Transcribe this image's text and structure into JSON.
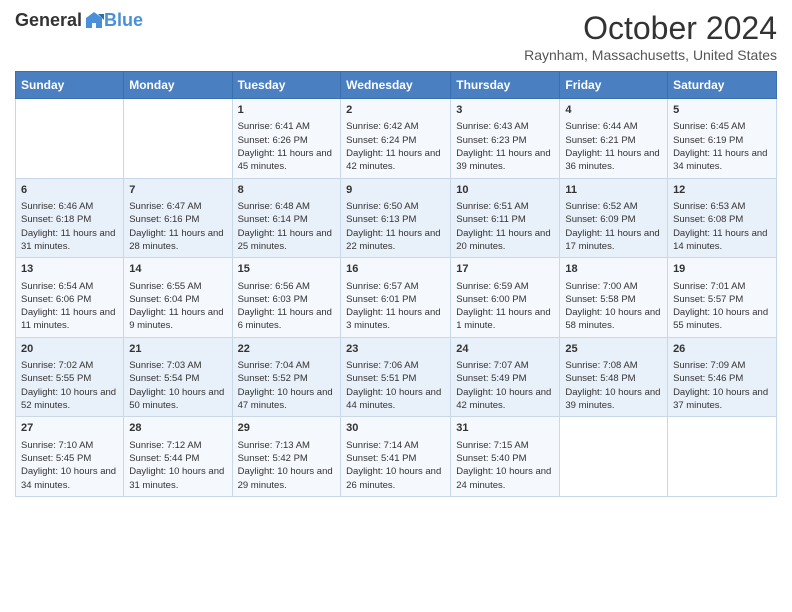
{
  "header": {
    "logo": {
      "general": "General",
      "blue": "Blue"
    },
    "title": "October 2024",
    "location": "Raynham, Massachusetts, United States"
  },
  "days_of_week": [
    "Sunday",
    "Monday",
    "Tuesday",
    "Wednesday",
    "Thursday",
    "Friday",
    "Saturday"
  ],
  "weeks": [
    [
      {
        "day": "",
        "data": ""
      },
      {
        "day": "",
        "data": ""
      },
      {
        "day": "1",
        "data": "Sunrise: 6:41 AM\nSunset: 6:26 PM\nDaylight: 11 hours and 45 minutes."
      },
      {
        "day": "2",
        "data": "Sunrise: 6:42 AM\nSunset: 6:24 PM\nDaylight: 11 hours and 42 minutes."
      },
      {
        "day": "3",
        "data": "Sunrise: 6:43 AM\nSunset: 6:23 PM\nDaylight: 11 hours and 39 minutes."
      },
      {
        "day": "4",
        "data": "Sunrise: 6:44 AM\nSunset: 6:21 PM\nDaylight: 11 hours and 36 minutes."
      },
      {
        "day": "5",
        "data": "Sunrise: 6:45 AM\nSunset: 6:19 PM\nDaylight: 11 hours and 34 minutes."
      }
    ],
    [
      {
        "day": "6",
        "data": "Sunrise: 6:46 AM\nSunset: 6:18 PM\nDaylight: 11 hours and 31 minutes."
      },
      {
        "day": "7",
        "data": "Sunrise: 6:47 AM\nSunset: 6:16 PM\nDaylight: 11 hours and 28 minutes."
      },
      {
        "day": "8",
        "data": "Sunrise: 6:48 AM\nSunset: 6:14 PM\nDaylight: 11 hours and 25 minutes."
      },
      {
        "day": "9",
        "data": "Sunrise: 6:50 AM\nSunset: 6:13 PM\nDaylight: 11 hours and 22 minutes."
      },
      {
        "day": "10",
        "data": "Sunrise: 6:51 AM\nSunset: 6:11 PM\nDaylight: 11 hours and 20 minutes."
      },
      {
        "day": "11",
        "data": "Sunrise: 6:52 AM\nSunset: 6:09 PM\nDaylight: 11 hours and 17 minutes."
      },
      {
        "day": "12",
        "data": "Sunrise: 6:53 AM\nSunset: 6:08 PM\nDaylight: 11 hours and 14 minutes."
      }
    ],
    [
      {
        "day": "13",
        "data": "Sunrise: 6:54 AM\nSunset: 6:06 PM\nDaylight: 11 hours and 11 minutes."
      },
      {
        "day": "14",
        "data": "Sunrise: 6:55 AM\nSunset: 6:04 PM\nDaylight: 11 hours and 9 minutes."
      },
      {
        "day": "15",
        "data": "Sunrise: 6:56 AM\nSunset: 6:03 PM\nDaylight: 11 hours and 6 minutes."
      },
      {
        "day": "16",
        "data": "Sunrise: 6:57 AM\nSunset: 6:01 PM\nDaylight: 11 hours and 3 minutes."
      },
      {
        "day": "17",
        "data": "Sunrise: 6:59 AM\nSunset: 6:00 PM\nDaylight: 11 hours and 1 minute."
      },
      {
        "day": "18",
        "data": "Sunrise: 7:00 AM\nSunset: 5:58 PM\nDaylight: 10 hours and 58 minutes."
      },
      {
        "day": "19",
        "data": "Sunrise: 7:01 AM\nSunset: 5:57 PM\nDaylight: 10 hours and 55 minutes."
      }
    ],
    [
      {
        "day": "20",
        "data": "Sunrise: 7:02 AM\nSunset: 5:55 PM\nDaylight: 10 hours and 52 minutes."
      },
      {
        "day": "21",
        "data": "Sunrise: 7:03 AM\nSunset: 5:54 PM\nDaylight: 10 hours and 50 minutes."
      },
      {
        "day": "22",
        "data": "Sunrise: 7:04 AM\nSunset: 5:52 PM\nDaylight: 10 hours and 47 minutes."
      },
      {
        "day": "23",
        "data": "Sunrise: 7:06 AM\nSunset: 5:51 PM\nDaylight: 10 hours and 44 minutes."
      },
      {
        "day": "24",
        "data": "Sunrise: 7:07 AM\nSunset: 5:49 PM\nDaylight: 10 hours and 42 minutes."
      },
      {
        "day": "25",
        "data": "Sunrise: 7:08 AM\nSunset: 5:48 PM\nDaylight: 10 hours and 39 minutes."
      },
      {
        "day": "26",
        "data": "Sunrise: 7:09 AM\nSunset: 5:46 PM\nDaylight: 10 hours and 37 minutes."
      }
    ],
    [
      {
        "day": "27",
        "data": "Sunrise: 7:10 AM\nSunset: 5:45 PM\nDaylight: 10 hours and 34 minutes."
      },
      {
        "day": "28",
        "data": "Sunrise: 7:12 AM\nSunset: 5:44 PM\nDaylight: 10 hours and 31 minutes."
      },
      {
        "day": "29",
        "data": "Sunrise: 7:13 AM\nSunset: 5:42 PM\nDaylight: 10 hours and 29 minutes."
      },
      {
        "day": "30",
        "data": "Sunrise: 7:14 AM\nSunset: 5:41 PM\nDaylight: 10 hours and 26 minutes."
      },
      {
        "day": "31",
        "data": "Sunrise: 7:15 AM\nSunset: 5:40 PM\nDaylight: 10 hours and 24 minutes."
      },
      {
        "day": "",
        "data": ""
      },
      {
        "day": "",
        "data": ""
      }
    ]
  ]
}
